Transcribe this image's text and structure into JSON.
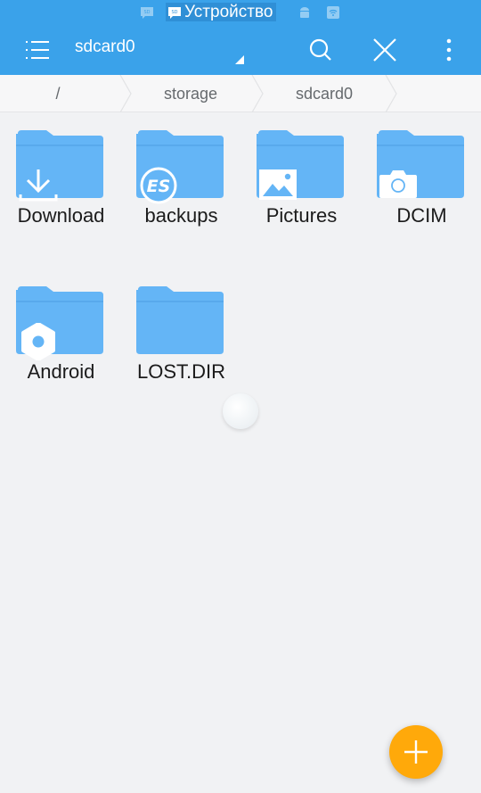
{
  "status_bar": {
    "notification_text": "Устройство",
    "icons": [
      "sd-card-icon",
      "sd-card-icon",
      "android-icon",
      "wifi-icon"
    ]
  },
  "toolbar": {
    "title": "sdcard0",
    "menu_icon": "list-menu-icon",
    "search_icon": "search-icon",
    "close_icon": "close-icon",
    "more_icon": "more-vertical-icon"
  },
  "breadcrumb": {
    "items": [
      {
        "label": "/"
      },
      {
        "label": "storage"
      },
      {
        "label": "sdcard0"
      }
    ]
  },
  "files": [
    {
      "name": "Download",
      "badge": "download-icon"
    },
    {
      "name": "backups",
      "badge": "es-logo-icon"
    },
    {
      "name": "Pictures",
      "badge": "image-icon"
    },
    {
      "name": "DCIM",
      "badge": "camera-icon"
    },
    {
      "name": "Android",
      "badge": "gear-icon"
    },
    {
      "name": "LOST.DIR",
      "badge": ""
    }
  ],
  "fab": {
    "icon": "plus-icon"
  },
  "colors": {
    "primary": "#3aa2ea",
    "folder": "#64b5f6",
    "fab": "#ffa90a",
    "background": "#f1f2f4"
  }
}
